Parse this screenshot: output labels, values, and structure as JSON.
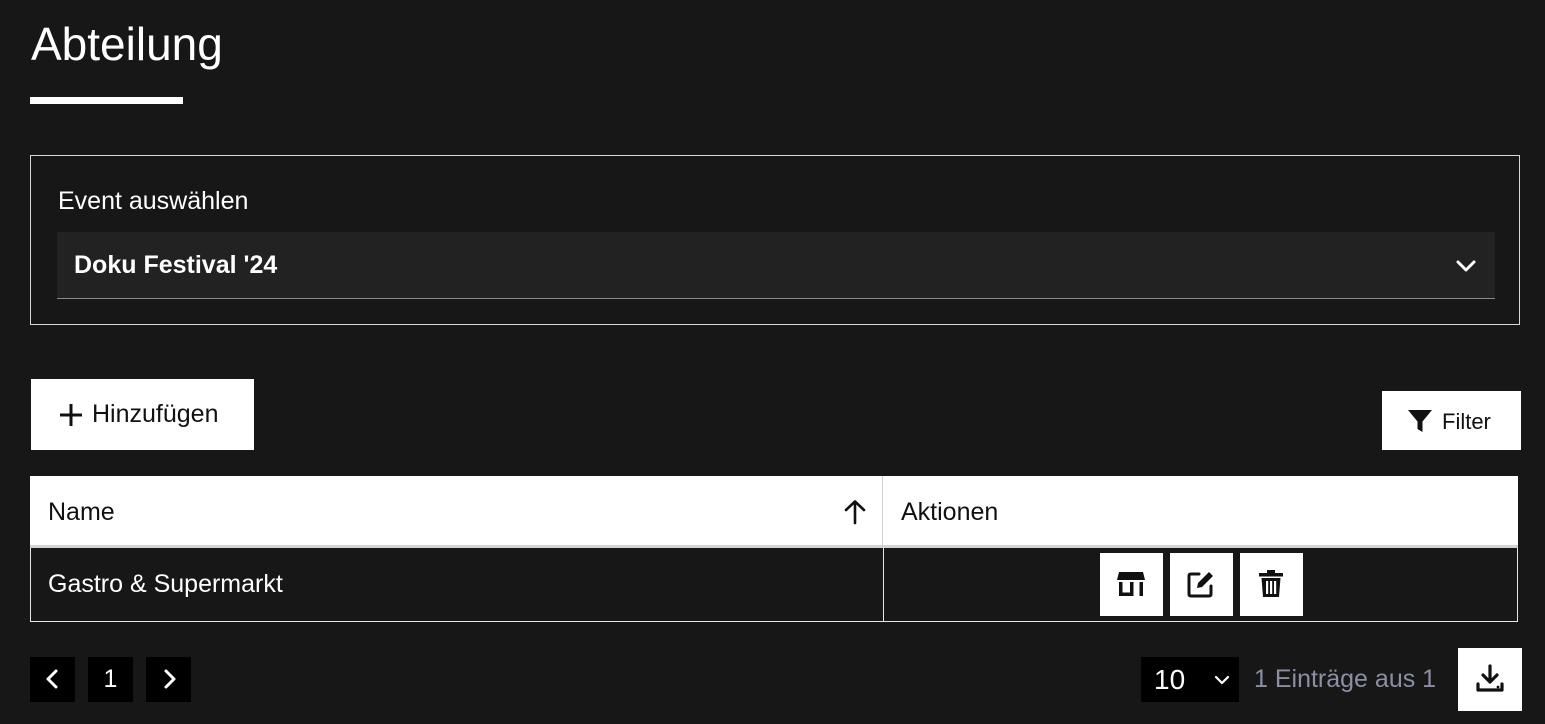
{
  "page": {
    "title": "Abteilung"
  },
  "event_selector": {
    "label": "Event auswählen",
    "selected": "Doku Festival '24"
  },
  "toolbar": {
    "add_label": "Hinzufügen",
    "filter_label": "Filter"
  },
  "table": {
    "columns": [
      "Name",
      "Aktionen"
    ],
    "sort": {
      "column": "Name",
      "direction": "ascending"
    },
    "rows": [
      {
        "name": "Gastro & Supermarkt",
        "actions": [
          "store-icon",
          "edit-icon",
          "trash-icon"
        ]
      }
    ]
  },
  "pagination": {
    "current_page": "1",
    "page_size": "10",
    "entries_info": "1 Einträge aus 1"
  },
  "colors": {
    "background": "#171717",
    "surface": "#222222",
    "button": "#ffffff",
    "muted_text": "#8b8fa3"
  }
}
